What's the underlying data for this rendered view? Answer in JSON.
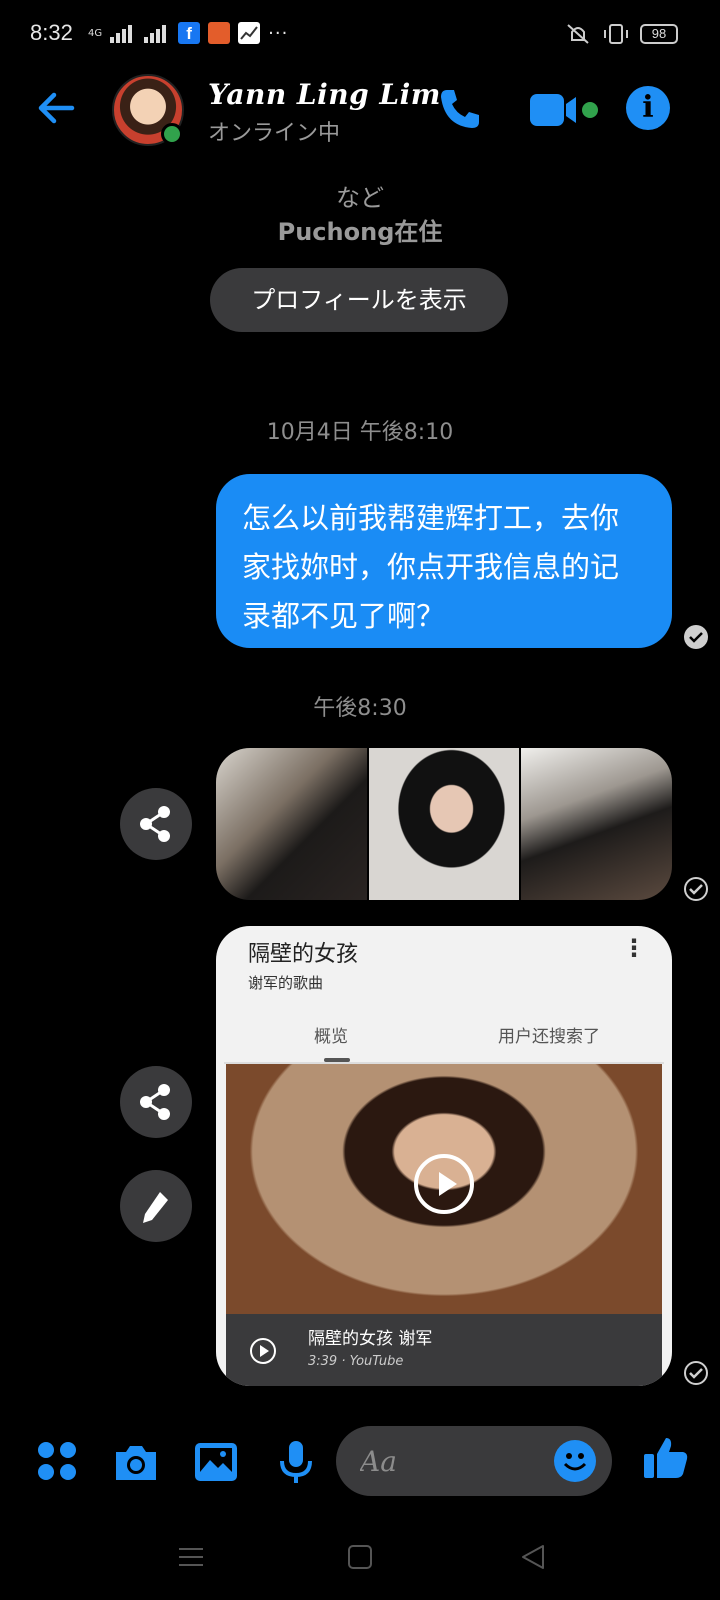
{
  "status_bar": {
    "time": "8:32",
    "network": "4G",
    "fb_letter": "f",
    "more_dots": "···",
    "battery": "98"
  },
  "header": {
    "contact_name": "Yann Ling Lim",
    "presence": "オンライン中"
  },
  "profile_snippet": {
    "line1": "など",
    "line2": "Puchong在住",
    "view_profile_label": "プロフィールを表示"
  },
  "timestamps": {
    "first": "10月4日 午後8:10",
    "second": "午後8:30"
  },
  "messages": [
    {
      "text": "怎么以前我帮建辉打工，去你家找妳时，你点开我信息的记录都不见了啊？"
    }
  ],
  "link_card": {
    "title": "隔壁的女孩",
    "subtitle": "谢军的歌曲",
    "more": "⋮",
    "tabs": [
      "概览",
      "用户还搜索了"
    ],
    "video_title": "隔壁的女孩 谢军",
    "video_meta": "3:39 · YouTube"
  },
  "composer": {
    "placeholder": "Aa"
  },
  "colors": {
    "accent": "#1f8ff5",
    "bubble": "#1a8cf5",
    "online": "#31a24c"
  }
}
